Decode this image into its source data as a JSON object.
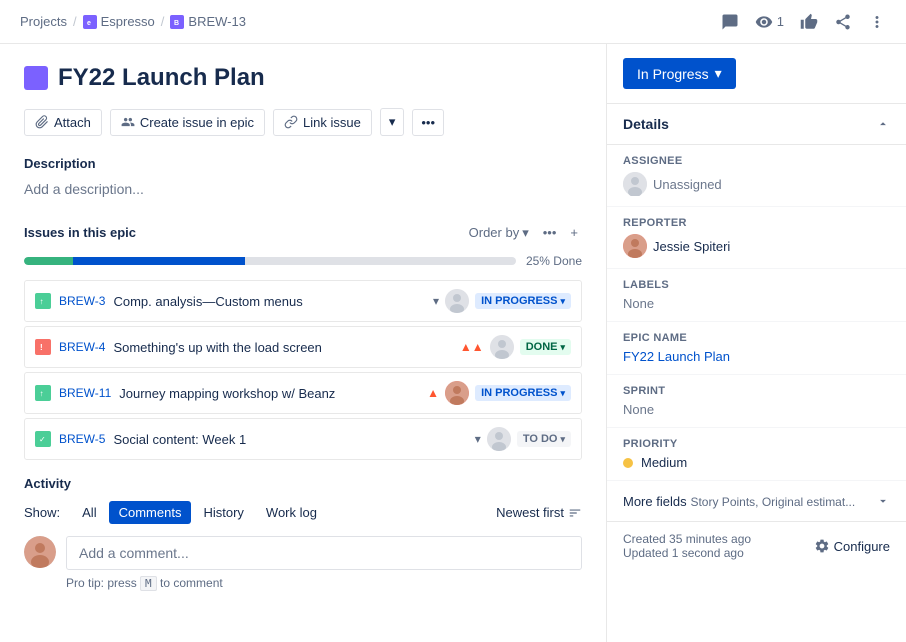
{
  "breadcrumb": {
    "projects_label": "Projects",
    "espresso_label": "Espresso",
    "brew_label": "BREW-13",
    "sep": "/"
  },
  "nav": {
    "watch_count": "1",
    "watch_label": "1"
  },
  "header": {
    "title": "FY22 Launch Plan",
    "status": "In Progress",
    "status_chevron": "▾"
  },
  "toolbar": {
    "attach_label": "Attach",
    "create_issue_label": "Create issue in epic",
    "link_issue_label": "Link issue"
  },
  "description": {
    "label": "Description",
    "placeholder": "Add a description..."
  },
  "issues": {
    "title": "Issues in this epic",
    "order_by_label": "Order by",
    "progress_pct": "25% Done",
    "green_width": "10%",
    "blue_width": "35%",
    "rows": [
      {
        "key": "BREW-3",
        "summary": "Comp. analysis—Custom menus",
        "status": "IN PROGRESS",
        "status_class": "status-in-progress",
        "type_class": "issue-type-green",
        "priority": "down"
      },
      {
        "key": "BREW-4",
        "summary": "Something's up with the load screen",
        "status": "DONE",
        "status_class": "status-done",
        "type_class": "issue-type-red",
        "priority": "up"
      },
      {
        "key": "BREW-11",
        "summary": "Journey mapping workshop w/ Beanz",
        "status": "IN PROGRESS",
        "status_class": "status-in-progress",
        "type_class": "issue-type-green",
        "priority": "up"
      },
      {
        "key": "BREW-5",
        "summary": "Social content: Week 1",
        "status": "TO DO",
        "status_class": "status-todo",
        "type_class": "issue-type-check",
        "priority": "down"
      }
    ]
  },
  "activity": {
    "title": "Activity",
    "show_label": "Show:",
    "tabs": [
      {
        "label": "All",
        "active": false
      },
      {
        "label": "Comments",
        "active": true
      },
      {
        "label": "History",
        "active": false
      },
      {
        "label": "Work log",
        "active": false
      }
    ],
    "newest_first": "Newest first",
    "comment_placeholder": "Add a comment...",
    "pro_tip": "Pro tip: press",
    "pro_tip_key": "M",
    "pro_tip_suffix": "to comment"
  },
  "details": {
    "title": "Details",
    "assignee_label": "Assignee",
    "assignee_value": "Unassigned",
    "reporter_label": "Reporter",
    "reporter_value": "Jessie Spiteri",
    "labels_label": "Labels",
    "labels_value": "None",
    "epic_name_label": "Epic Name",
    "epic_name_value": "FY22 Launch Plan",
    "sprint_label": "Sprint",
    "sprint_value": "None",
    "priority_label": "Priority",
    "priority_value": "Medium"
  },
  "more_fields": {
    "label": "More fields",
    "sub": "Story Points, Original estimat..."
  },
  "footer": {
    "created": "Created 35 minutes ago",
    "updated": "Updated 1 second ago",
    "configure": "Configure"
  }
}
